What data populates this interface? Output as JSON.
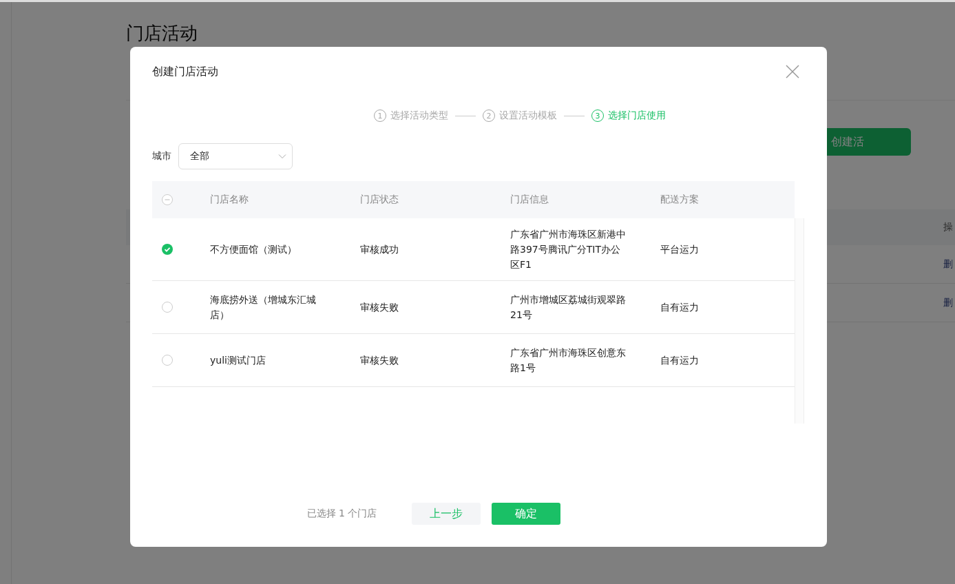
{
  "page": {
    "title": "门店活动",
    "create_button": "创建活",
    "table": {
      "header": "操",
      "rows": [
        "删",
        "删"
      ]
    }
  },
  "dialog": {
    "title": "创建门店活动",
    "steps": [
      {
        "number": "1",
        "label": "选择活动类型",
        "selected": false
      },
      {
        "number": "2",
        "label": "设置活动模板",
        "selected": false
      },
      {
        "number": "3",
        "label": "选择门店使用",
        "selected": true
      }
    ],
    "filter": {
      "label": "城市",
      "value": "全部"
    },
    "table": {
      "select_all": {
        "indeterminate": true
      },
      "columns": [
        "门店名称",
        "门店状态",
        "门店信息",
        "配送方案"
      ],
      "rows": [
        {
          "checked": true,
          "cells": [
            "不方便面馆（测试）",
            "审核成功",
            "广东省广州市海珠区新港中路397号腾讯广分TIT办公区F1",
            "平台运力"
          ]
        },
        {
          "checked": false,
          "cells": [
            "海底捞外送（增城东汇城店）",
            "审核失败",
            "广州市增城区荔城街观翠路21号",
            "自有运力"
          ]
        },
        {
          "checked": false,
          "cells": [
            "yuli测试门店",
            "审核失败",
            "广东省广州市海珠区创意东路1号",
            "自有运力"
          ]
        }
      ]
    },
    "footer": {
      "summary": "已选择 1 个门店",
      "back_button": "上一步",
      "confirm_button": "确定"
    }
  }
}
